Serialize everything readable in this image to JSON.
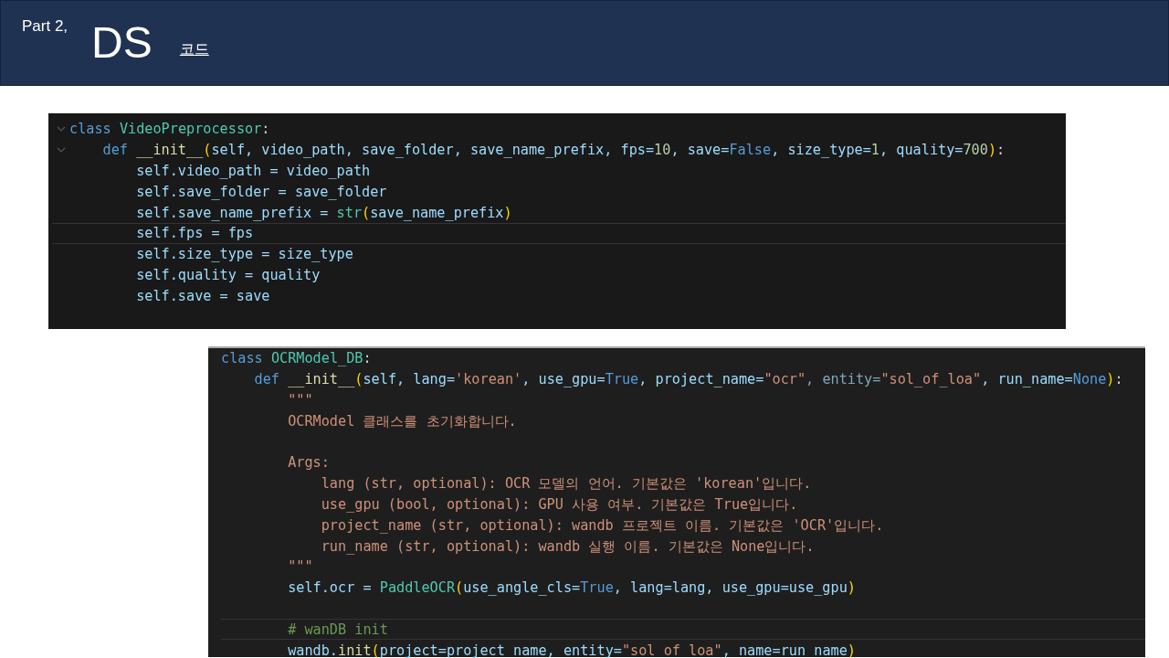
{
  "header": {
    "part": "Part 2,",
    "title": "DS",
    "subtitle": "코드"
  },
  "code_panels": [
    {
      "lines": [
        {
          "foldable": true,
          "highlighted": false,
          "tokens": [
            {
              "t": "class ",
              "color": "#569cd6"
            },
            {
              "t": "VideoPreprocessor",
              "color": "#4ec9b0"
            },
            {
              "t": ":",
              "color": "#d4d4d4"
            }
          ]
        },
        {
          "foldable": true,
          "highlighted": false,
          "tokens": [
            {
              "t": "    def ",
              "color": "#569cd6"
            },
            {
              "t": "__init__",
              "color": "#dcdcaa"
            },
            {
              "t": "(",
              "color": "#ffd700"
            },
            {
              "t": "self, video_path, save_folder, save_name_prefix, fps=",
              "color": "#9cdcfe"
            },
            {
              "t": "10",
              "color": "#b5cea8"
            },
            {
              "t": ", save=",
              "color": "#9cdcfe"
            },
            {
              "t": "False",
              "color": "#569cd6"
            },
            {
              "t": ", size_type=",
              "color": "#9cdcfe"
            },
            {
              "t": "1",
              "color": "#b5cea8"
            },
            {
              "t": ", quality=",
              "color": "#9cdcfe"
            },
            {
              "t": "700",
              "color": "#b5cea8"
            },
            {
              "t": ")",
              "color": "#ffd700"
            },
            {
              "t": ":",
              "color": "#d4d4d4"
            }
          ]
        },
        {
          "foldable": false,
          "highlighted": false,
          "tokens": [
            {
              "t": "        self.video_path = video_path",
              "color": "#9cdcfe"
            }
          ]
        },
        {
          "foldable": false,
          "highlighted": false,
          "tokens": [
            {
              "t": "        self.save_folder = save_folder",
              "color": "#9cdcfe"
            }
          ]
        },
        {
          "foldable": false,
          "highlighted": false,
          "tokens": [
            {
              "t": "        self.save_name_prefix = ",
              "color": "#9cdcfe"
            },
            {
              "t": "str",
              "color": "#4ec9b0"
            },
            {
              "t": "(",
              "color": "#ffd700"
            },
            {
              "t": "save_name_prefix",
              "color": "#9cdcfe"
            },
            {
              "t": ")",
              "color": "#ffd700"
            }
          ]
        },
        {
          "foldable": false,
          "highlighted": true,
          "tokens": [
            {
              "t": "        self.fps = fps",
              "color": "#9cdcfe"
            }
          ]
        },
        {
          "foldable": false,
          "highlighted": false,
          "tokens": [
            {
              "t": "        self.size_type = size_type",
              "color": "#9cdcfe"
            }
          ]
        },
        {
          "foldable": false,
          "highlighted": false,
          "tokens": [
            {
              "t": "        self.quality = quality",
              "color": "#9cdcfe"
            }
          ]
        },
        {
          "foldable": false,
          "highlighted": false,
          "tokens": [
            {
              "t": "        self.save = save",
              "color": "#9cdcfe"
            }
          ]
        }
      ]
    },
    {
      "lines": [
        {
          "highlighted": false,
          "tokens": [
            {
              "t": "class ",
              "color": "#569cd6"
            },
            {
              "t": "OCRModel_DB",
              "color": "#4ec9b0"
            },
            {
              "t": ":",
              "color": "#d4d4d4"
            }
          ]
        },
        {
          "highlighted": false,
          "tokens": [
            {
              "t": "    def ",
              "color": "#569cd6"
            },
            {
              "t": "__init__",
              "color": "#dcdcaa"
            },
            {
              "t": "(",
              "color": "#ffd700"
            },
            {
              "t": "self, lang=",
              "color": "#9cdcfe"
            },
            {
              "t": "'korean'",
              "color": "#ce9178"
            },
            {
              "t": ", use_gpu=",
              "color": "#9cdcfe"
            },
            {
              "t": "True",
              "color": "#569cd6"
            },
            {
              "t": ", project_name=",
              "color": "#9cdcfe"
            },
            {
              "t": "\"ocr\"",
              "color": "#ce9178"
            },
            {
              "t": ", entity=",
              "color": "#7fa6b8"
            },
            {
              "t": "\"sol_of_loa\"",
              "color": "#ce9178"
            },
            {
              "t": ", run_name=",
              "color": "#9cdcfe"
            },
            {
              "t": "None",
              "color": "#569cd6"
            },
            {
              "t": ")",
              "color": "#ffd700"
            },
            {
              "t": ":",
              "color": "#d4d4d4"
            }
          ]
        },
        {
          "highlighted": false,
          "tokens": [
            {
              "t": "        \"\"\"",
              "color": "#ce9178"
            }
          ]
        },
        {
          "highlighted": false,
          "tokens": [
            {
              "t": "        OCRModel 클래스를 초기화합니다.",
              "color": "#ce9178"
            }
          ]
        },
        {
          "highlighted": false
        },
        {
          "highlighted": false,
          "tokens": [
            {
              "t": "        Args:",
              "color": "#ce9178"
            }
          ]
        },
        {
          "highlighted": false,
          "tokens": [
            {
              "t": "            lang (str, optional): OCR 모델의 언어. 기본값은 'korean'입니다.",
              "color": "#ce9178"
            }
          ]
        },
        {
          "highlighted": false,
          "tokens": [
            {
              "t": "            use_gpu (bool, optional): GPU 사용 여부. 기본값은 True입니다.",
              "color": "#ce9178"
            }
          ]
        },
        {
          "highlighted": false,
          "tokens": [
            {
              "t": "            project_name (str, optional): wandb 프로젝트 이름. 기본값은 'OCR'입니다.",
              "color": "#ce9178"
            }
          ]
        },
        {
          "highlighted": false,
          "tokens": [
            {
              "t": "            run_name (str, optional): wandb 실행 이름. 기본값은 None입니다.",
              "color": "#ce9178"
            }
          ]
        },
        {
          "highlighted": false,
          "tokens": [
            {
              "t": "        \"\"\"",
              "color": "#ce9178"
            }
          ]
        },
        {
          "highlighted": false,
          "tokens": [
            {
              "t": "        self.ocr = ",
              "color": "#9cdcfe"
            },
            {
              "t": "PaddleOCR",
              "color": "#4ec9b0"
            },
            {
              "t": "(",
              "color": "#ffd700"
            },
            {
              "t": "use_angle_cls=",
              "color": "#9cdcfe"
            },
            {
              "t": "True",
              "color": "#569cd6"
            },
            {
              "t": ", lang=lang, use_gpu=use_gpu",
              "color": "#9cdcfe"
            },
            {
              "t": ")",
              "color": "#ffd700"
            }
          ]
        },
        {
          "highlighted": false
        },
        {
          "highlighted": true,
          "tokens": [
            {
              "t": "        # wanDB init",
              "color": "#6a9955"
            }
          ]
        },
        {
          "highlighted": false,
          "tokens": [
            {
              "t": "        wandb.",
              "color": "#9cdcfe"
            },
            {
              "t": "init",
              "color": "#dcdcaa"
            },
            {
              "t": "(",
              "color": "#ffd700"
            },
            {
              "t": "project=project_name, entity=",
              "color": "#9cdcfe"
            },
            {
              "t": "\"sol_of_loa\"",
              "color": "#ce9178"
            },
            {
              "t": ", name=run_name",
              "color": "#9cdcfe"
            },
            {
              "t": ")",
              "color": "#ffd700"
            }
          ]
        }
      ]
    }
  ]
}
